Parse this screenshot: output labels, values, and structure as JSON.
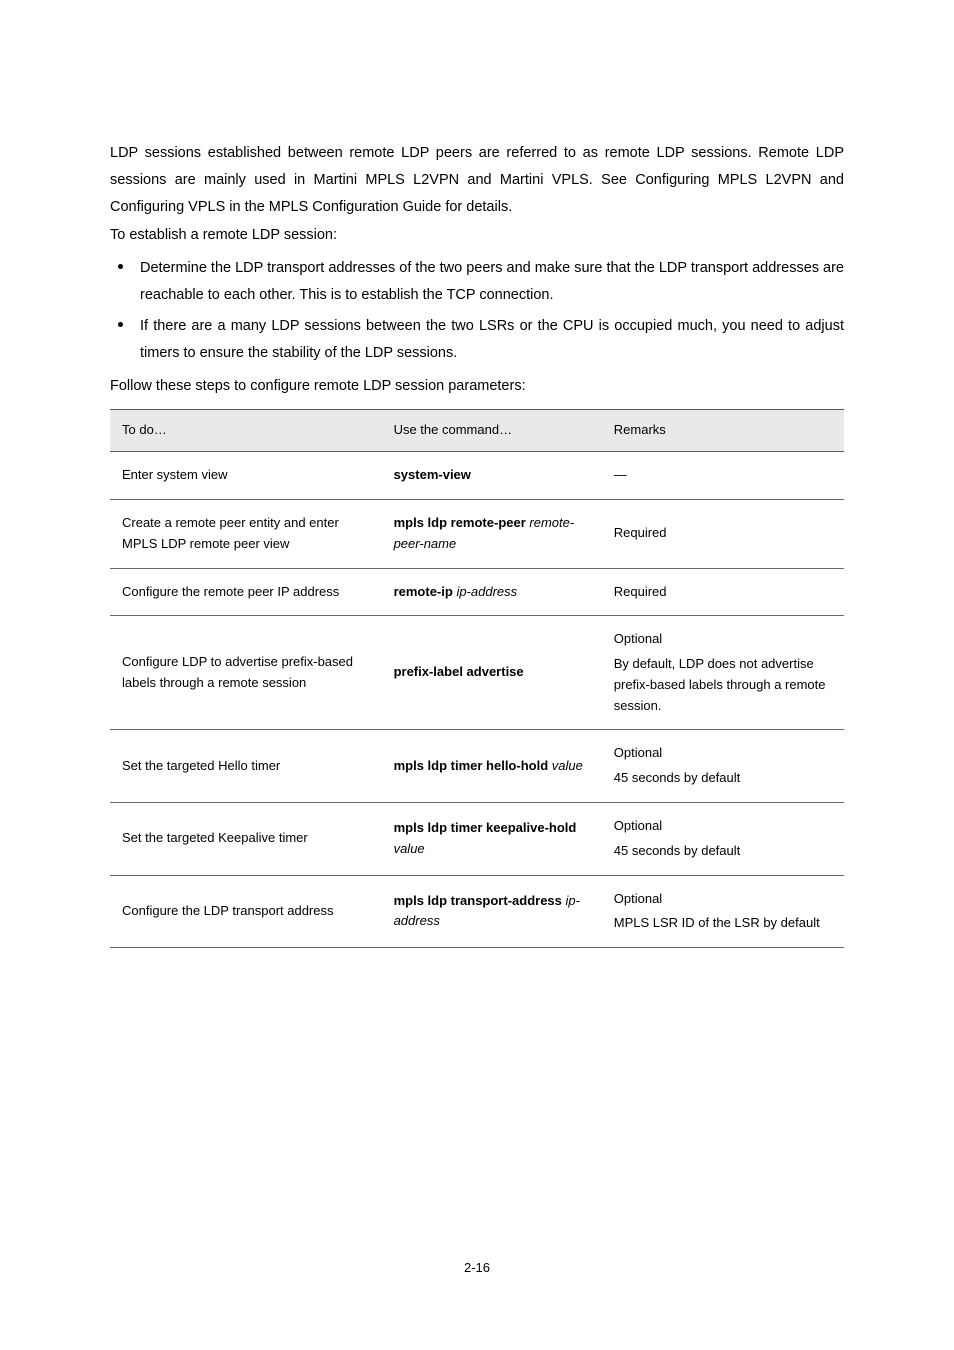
{
  "intro": {
    "p1": "LDP sessions established between remote LDP peers are referred to as remote LDP sessions. Remote LDP sessions are mainly used in Martini MPLS L2VPN and Martini VPLS. See ",
    "p2a": "Configuring MPLS L2VPN",
    "p2b": " and ",
    "p2c": "Configuring VPLS",
    "p2d": " in the ",
    "p2e": "MPLS Configuration Guide",
    "p2f": " for details."
  },
  "lead": "To establish a remote LDP session:",
  "bullets": [
    "Determine the LDP transport addresses of the two peers and make sure that the LDP transport addresses are reachable to each other. This is to establish the TCP connection.",
    "If there are a many LDP sessions between the two LSRs or the CPU is occupied much, you need to adjust timers to ensure the stability of the LDP sessions."
  ],
  "follow": "Follow these steps to configure remote LDP session parameters:",
  "table": {
    "headers": [
      "To do…",
      "Use the command…",
      "Remarks"
    ],
    "rows": [
      {
        "todo": "Enter system view",
        "cmd": [
          [
            "system-view",
            "cmd"
          ]
        ],
        "remarks": [
          "—"
        ]
      },
      {
        "todo": "Create a remote peer entity and enter MPLS LDP remote peer view",
        "cmd": [
          [
            "mpls ldp remote-peer",
            "cmd"
          ],
          [
            " ",
            "txt"
          ],
          [
            "remote-peer-name",
            "arg"
          ]
        ],
        "remarks": [
          "Required"
        ]
      },
      {
        "todo": "Configure the remote peer IP address",
        "cmd": [
          [
            "remote-ip",
            "cmd"
          ],
          [
            " ",
            "txt"
          ],
          [
            "ip-address",
            "arg"
          ]
        ],
        "remarks": [
          "Required"
        ]
      },
      {
        "todo": "Configure LDP to advertise prefix-based labels through a remote session",
        "cmd": [
          [
            "prefix-label advertise",
            "cmd"
          ]
        ],
        "remarks": [
          "Optional",
          "By default, LDP does not advertise prefix-based labels through a remote session."
        ]
      },
      {
        "todo": "Set the targeted Hello timer",
        "cmd": [
          [
            "mpls ldp timer hello-hold",
            "cmd"
          ],
          [
            " ",
            "txt"
          ],
          [
            "value",
            "arg"
          ]
        ],
        "remarks": [
          "Optional",
          "45 seconds by default"
        ]
      },
      {
        "todo": "Set the targeted Keepalive timer",
        "cmd": [
          [
            "mpls ldp timer keepalive-hold",
            "cmd"
          ],
          [
            " ",
            "txt"
          ],
          [
            "value",
            "arg"
          ]
        ],
        "remarks": [
          "Optional",
          "45 seconds by default"
        ]
      },
      {
        "todo": "Configure the LDP transport address",
        "cmd": [
          [
            "mpls ldp transport-address",
            "cmd"
          ],
          [
            " ",
            "txt"
          ],
          [
            "ip-address",
            "arg"
          ]
        ],
        "remarks": [
          "Optional",
          "MPLS LSR ID of the LSR by default"
        ]
      }
    ]
  },
  "pagenum": "2-16"
}
